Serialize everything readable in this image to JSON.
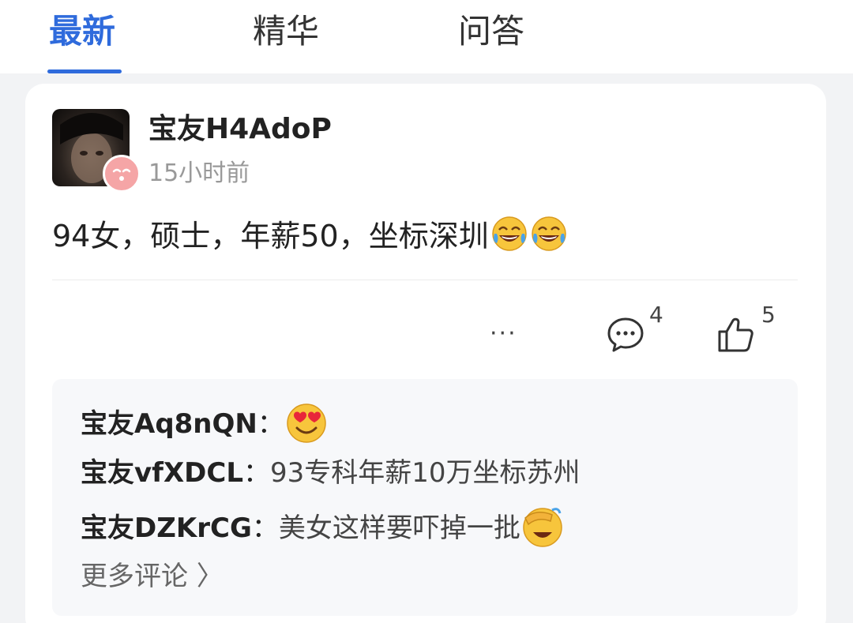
{
  "tabs": [
    {
      "label": "最新",
      "active": true
    },
    {
      "label": "精华",
      "active": false
    },
    {
      "label": "问答",
      "active": false
    }
  ],
  "post": {
    "username": "宝友H4AdoP",
    "time": "15小时前",
    "text": "94女，硕士，年薪50，坐标深圳",
    "trailing_emojis": [
      "tears-of-joy-emoji",
      "tears-of-joy-emoji"
    ],
    "comment_count": "4",
    "like_count": "5",
    "more_label": "···"
  },
  "comments": [
    {
      "author": "宝友Aq8nQN",
      "separator": "：",
      "text": "",
      "emoji": "heart-eyes-emoji"
    },
    {
      "author": "宝友vfXDCL",
      "separator": "：",
      "text": "93专科年薪10万坐标苏州",
      "emoji": ""
    },
    {
      "author": "宝友DZKrCG",
      "separator": "：",
      "text": "美女这样要吓掉一批",
      "emoji": "face-palm-emoji"
    }
  ],
  "more_comments_label": "更多评论 〉",
  "colors": {
    "accent": "#2f6bdc",
    "text": "#222222",
    "muted": "#999999",
    "badge": "#f5a5a6"
  }
}
